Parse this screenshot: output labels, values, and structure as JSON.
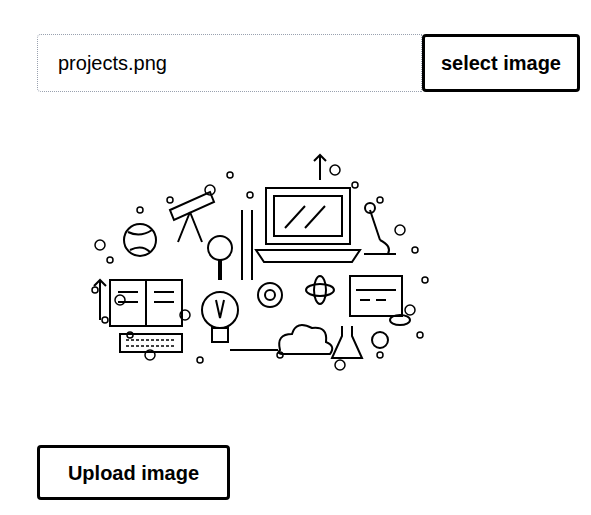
{
  "file_field": {
    "value": "projects.png",
    "button": "select image"
  },
  "preview": {
    "kind": "illustration"
  },
  "upload_button": {
    "label": "Upload image"
  }
}
